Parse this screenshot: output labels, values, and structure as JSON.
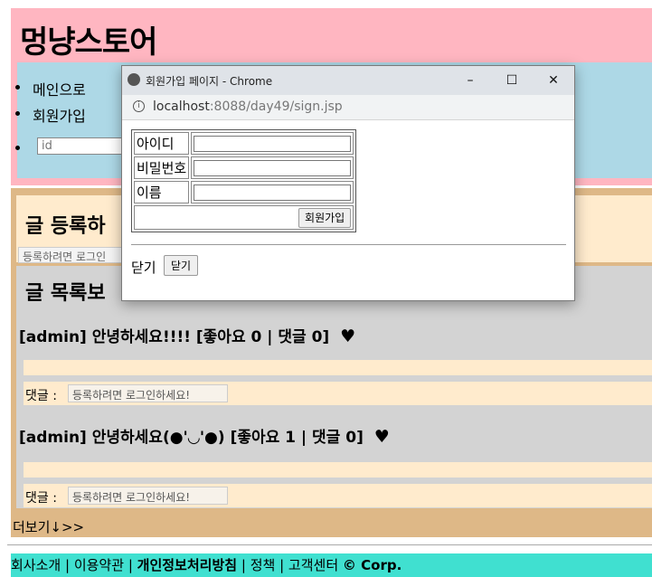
{
  "header": {
    "store_title": "멍냥스토어",
    "nav": [
      {
        "label": "메인으로"
      },
      {
        "label": "회원가입"
      }
    ],
    "id_placeholder": "id"
  },
  "write_section": {
    "title": "글 등록하",
    "disabled_text": "등록하려면 로그인"
  },
  "list_section": {
    "title": "글 목록보",
    "posts": [
      {
        "author": "[admin]",
        "title": "안녕하세요!!!!",
        "stats": "[좋아요 0 | 댓글 0]",
        "heart": "♥"
      },
      {
        "author": "[admin]",
        "title": "안녕하세요(●'◡'●)",
        "stats": "[좋아요 1 | 댓글 0]",
        "heart": "♥"
      }
    ],
    "comment_label": "댓글 :",
    "comment_placeholder": "등록하려면 로그인하세요!"
  },
  "more_link": "더보기↓>>",
  "footer": {
    "about": "회사소개",
    "terms": "이용약관",
    "privacy": "개인정보처리방침",
    "policy": "정책",
    "support": "고객센터",
    "copyright": "© Corp.",
    "sep": "|"
  },
  "popup": {
    "window_title": "회원가입 페이지 - Chrome",
    "url_host": "localhost",
    "url_rest": ":8088/day49/sign.jsp",
    "minimize": "–",
    "maximize": "☐",
    "close": "✕",
    "form": {
      "id_label": "아이디",
      "password_label": "비밀번호",
      "name_label": "이름",
      "submit_label": "회원가입"
    },
    "close_text": "닫기",
    "close_button": "닫기"
  },
  "colors": {
    "header_bg": "#ffb6c1",
    "nav_bg": "#add8e6",
    "main_bg": "#deb887",
    "card_bg": "#ffebcd",
    "list_bg": "#d3d3d3",
    "footer_bg": "#40e0d0"
  }
}
